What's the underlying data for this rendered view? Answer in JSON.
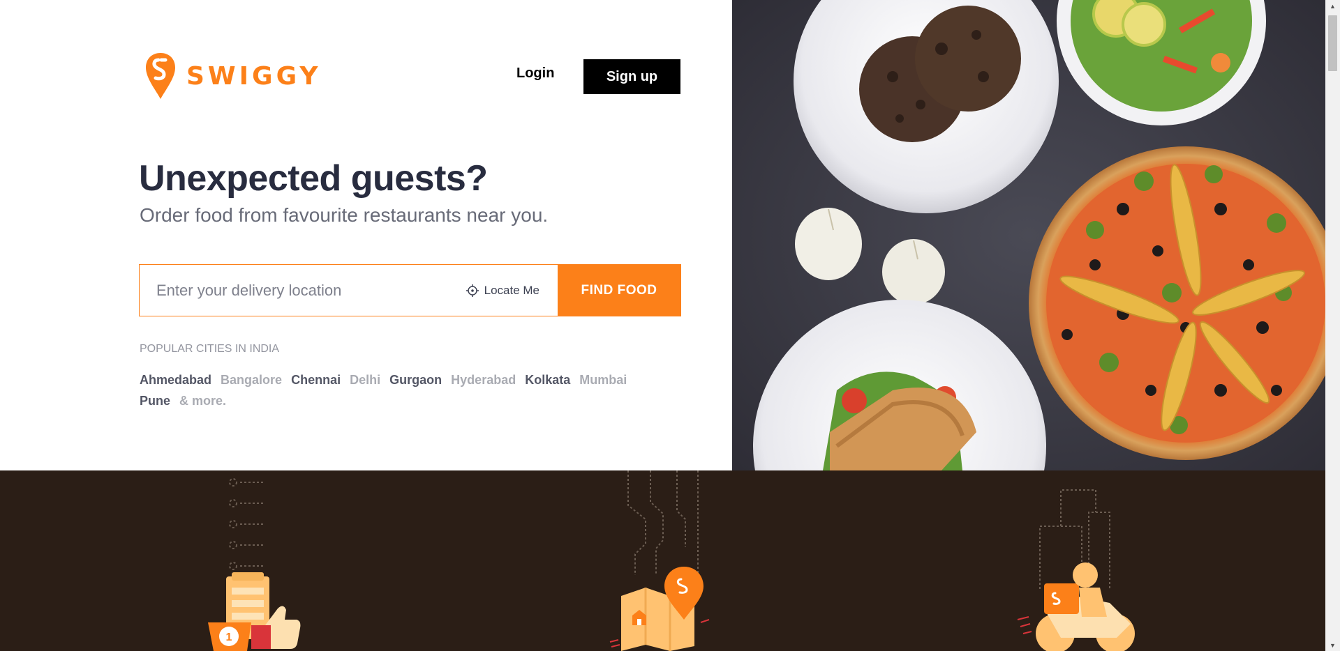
{
  "brand": {
    "name": "SWIGGY",
    "color": "#fc8019"
  },
  "nav": {
    "login_label": "Login",
    "signup_label": "Sign up"
  },
  "hero": {
    "headline": "Unexpected guests?",
    "subheadline": "Order food from favourite restaurants near you."
  },
  "search": {
    "placeholder": "Enter your delivery location",
    "value": "",
    "locate_label": "Locate Me",
    "locate_icon": "crosshair-icon",
    "submit_label": "FIND FOOD"
  },
  "cities": {
    "title": "POPULAR CITIES IN INDIA",
    "items": [
      "Ahmedabad",
      "Bangalore",
      "Chennai",
      "Delhi",
      "Gurgaon",
      "Hyderabad",
      "Kolkata",
      "Mumbai",
      "Pune"
    ],
    "more_label": "& more."
  },
  "colors": {
    "accent": "#fc8019",
    "dark_strip": "#2b1e16",
    "text_dark": "#282c3f",
    "text_muted": "#686b78"
  }
}
